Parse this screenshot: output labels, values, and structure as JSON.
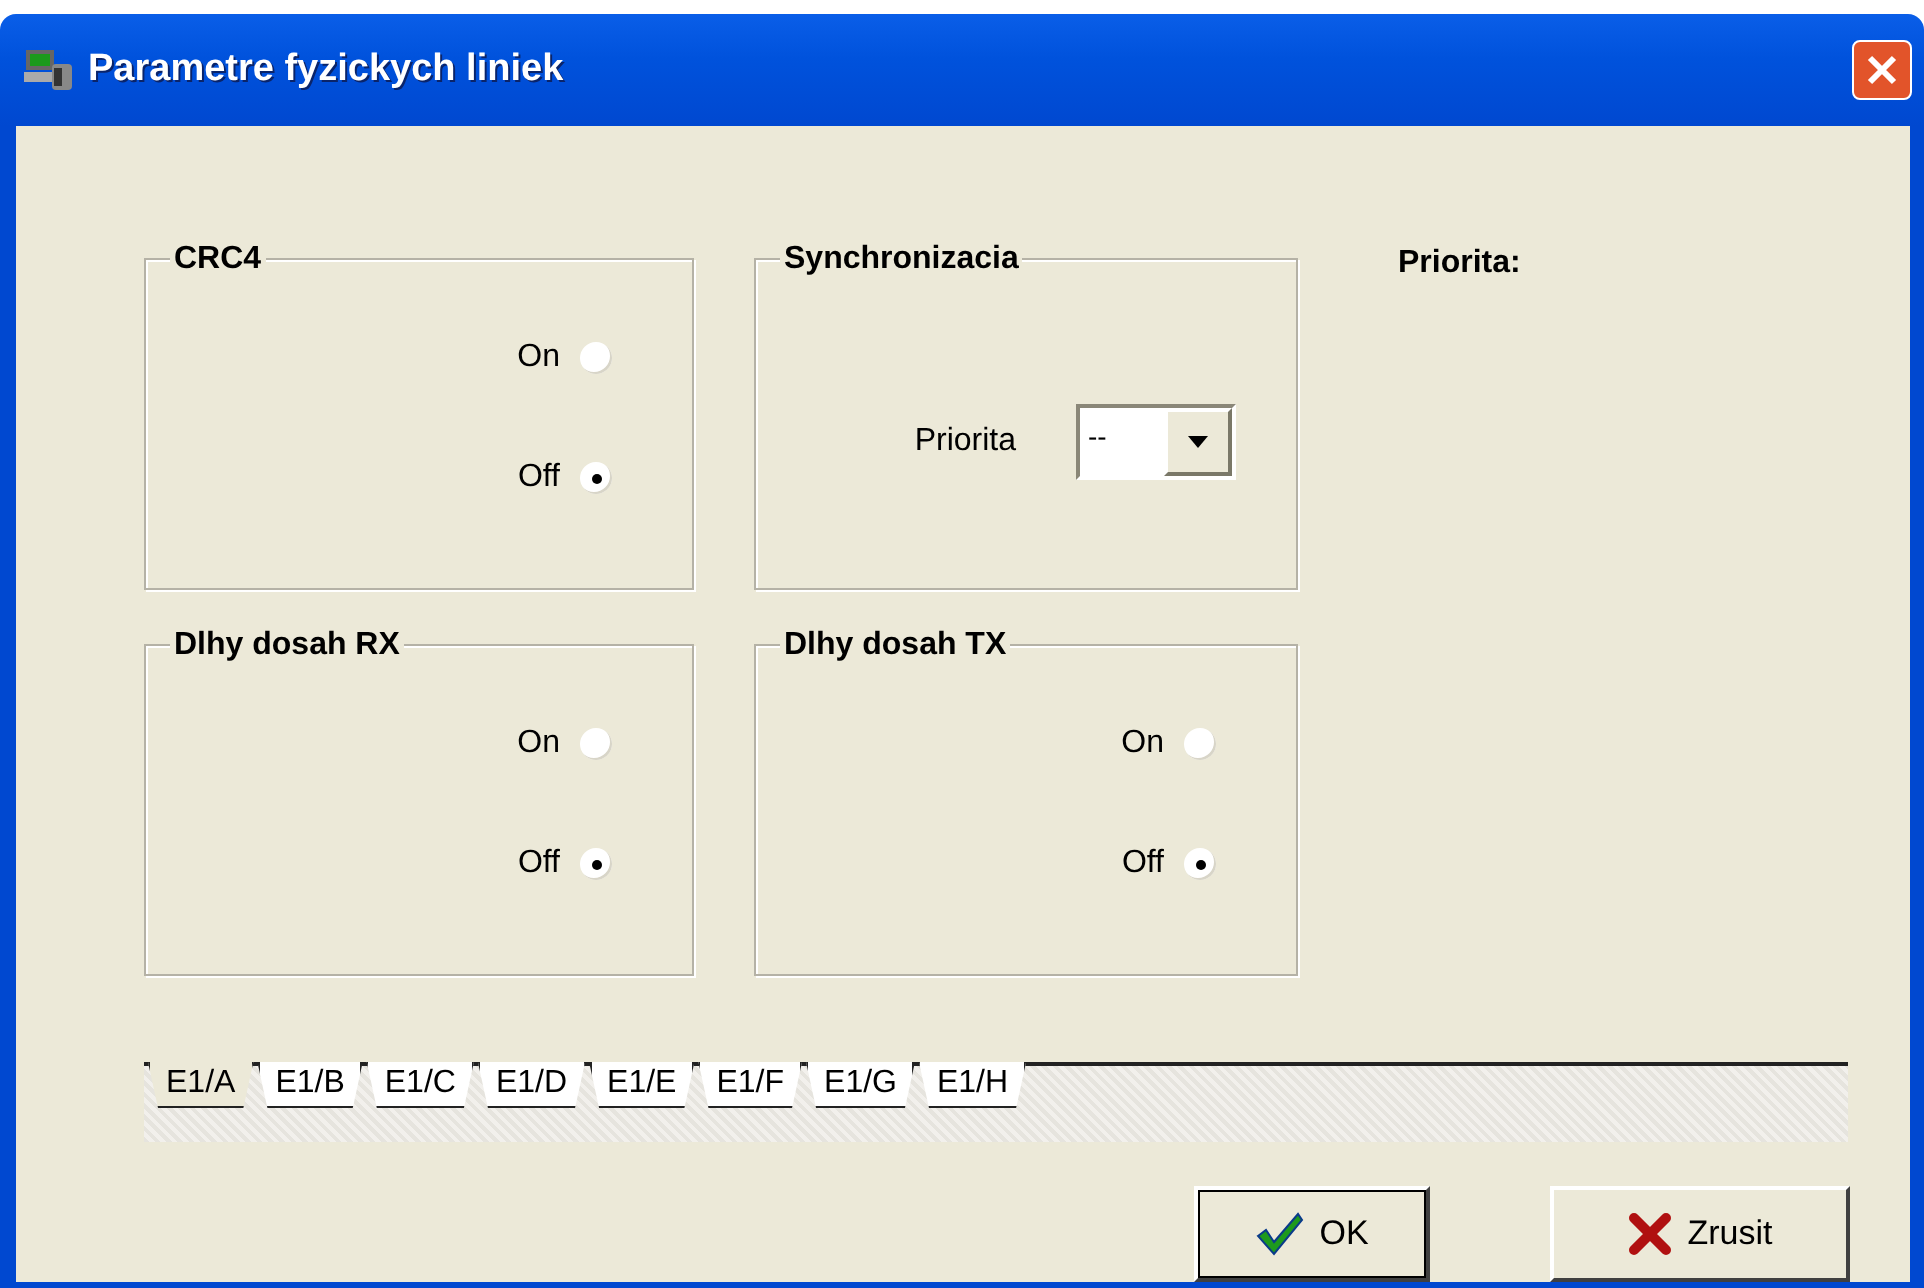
{
  "window": {
    "title": "Parametre fyzickych liniek"
  },
  "groups": [
    {
      "kind": "radio",
      "title": "CRC4",
      "options": [
        {
          "label": "On",
          "selected": false
        },
        {
          "label": "Off",
          "selected": true
        }
      ]
    },
    {
      "kind": "select",
      "title": "Synchronizacia",
      "label": "Priorita",
      "value": "--"
    },
    {
      "kind": "radio",
      "title": "Dlhy dosah RX",
      "options": [
        {
          "label": "On",
          "selected": false
        },
        {
          "label": "Off",
          "selected": true
        }
      ]
    },
    {
      "kind": "radio",
      "title": "Dlhy dosah TX",
      "options": [
        {
          "label": "On",
          "selected": false
        },
        {
          "label": "Off",
          "selected": true
        }
      ]
    }
  ],
  "side_label": "Priorita:",
  "tabs": [
    {
      "label": "E1/A",
      "selected": true
    },
    {
      "label": "E1/B",
      "selected": false
    },
    {
      "label": "E1/C",
      "selected": false
    },
    {
      "label": "E1/D",
      "selected": false
    },
    {
      "label": "E1/E",
      "selected": false
    },
    {
      "label": "E1/F",
      "selected": false
    },
    {
      "label": "E1/G",
      "selected": false
    },
    {
      "label": "E1/H",
      "selected": false
    }
  ],
  "buttons": [
    {
      "kind": "ok",
      "label": "OK"
    },
    {
      "kind": "cancel",
      "label": "Zrusit"
    }
  ]
}
